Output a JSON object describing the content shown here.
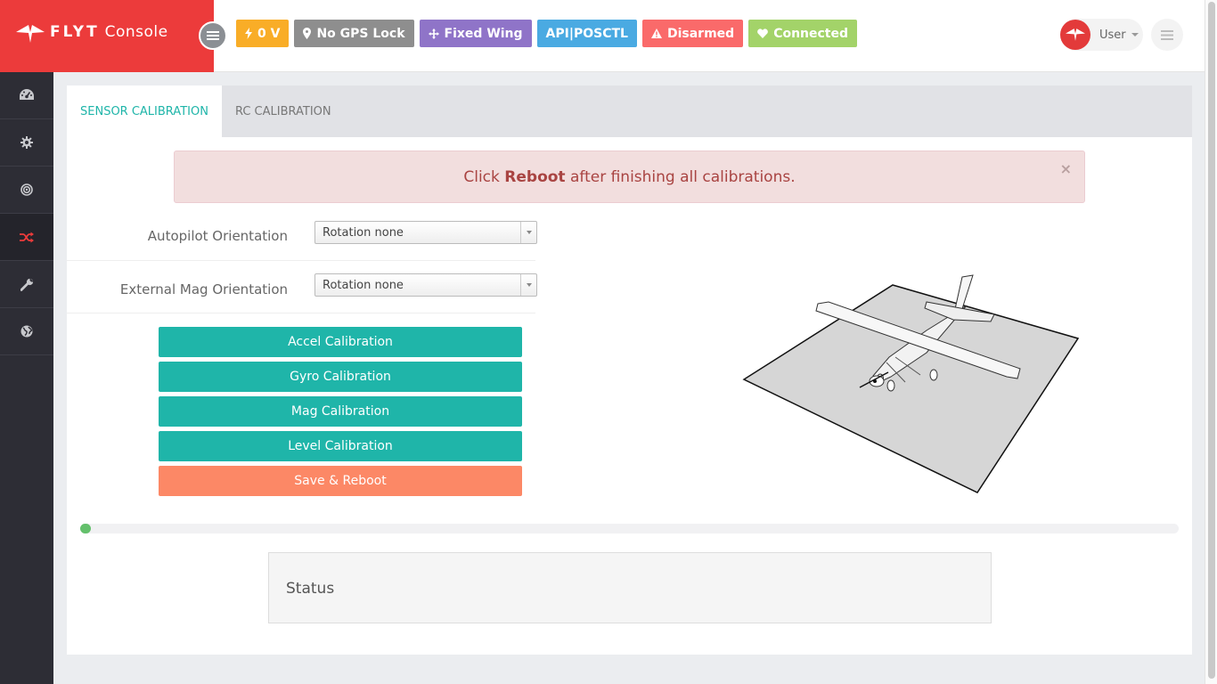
{
  "app": {
    "brand_bold": "FLYT",
    "brand_light": "Console"
  },
  "status_badges": [
    {
      "label": "0 V",
      "icon": "bolt-icon",
      "color": "#f9ad27"
    },
    {
      "label": "No GPS Lock",
      "icon": "map-marker-icon",
      "color": "#8e8e8e"
    },
    {
      "label": "Fixed Wing",
      "icon": "arrows-icon",
      "color": "#8f74c8"
    },
    {
      "label": "API|POSCTL",
      "icon": "",
      "color": "#4aaae2"
    },
    {
      "label": "Disarmed",
      "icon": "warning-icon",
      "color": "#fa6a6a"
    },
    {
      "label": "Connected",
      "icon": "heart-icon",
      "color": "#a3d369"
    }
  ],
  "user": {
    "name": "User"
  },
  "sidebar": {
    "items": [
      {
        "icon": "dashboard-icon",
        "active": false
      },
      {
        "icon": "gear-icon",
        "active": false
      },
      {
        "icon": "target-icon",
        "active": false
      },
      {
        "icon": "shuffle-icon",
        "active": true
      },
      {
        "icon": "wrench-icon",
        "active": false
      },
      {
        "icon": "globe-icon",
        "active": false
      }
    ]
  },
  "tabs": [
    {
      "label": "SENSOR CALIBRATION",
      "active": true
    },
    {
      "label": "RC CALIBRATION",
      "active": false
    }
  ],
  "alert": {
    "prefix": "Click",
    "strong": "Reboot",
    "suffix": "after finishing all calibrations.",
    "close": "×"
  },
  "form": {
    "autopilot_label": "Autopilot Orientation",
    "autopilot_value": "Rotation none",
    "mag_label": "External Mag Orientation",
    "mag_value": "Rotation none"
  },
  "buttons": {
    "accel": "Accel Calibration",
    "gyro": "Gyro Calibration",
    "mag": "Mag Calibration",
    "level": "Level Calibration",
    "save": "Save & Reboot"
  },
  "progress": {
    "percent": 1
  },
  "status": {
    "title": "Status"
  },
  "colors": {
    "brand": "#ec3b3b",
    "accent": "#1fb5a9",
    "warning_button": "#fc8866",
    "sidebar": "#2d2d35"
  }
}
